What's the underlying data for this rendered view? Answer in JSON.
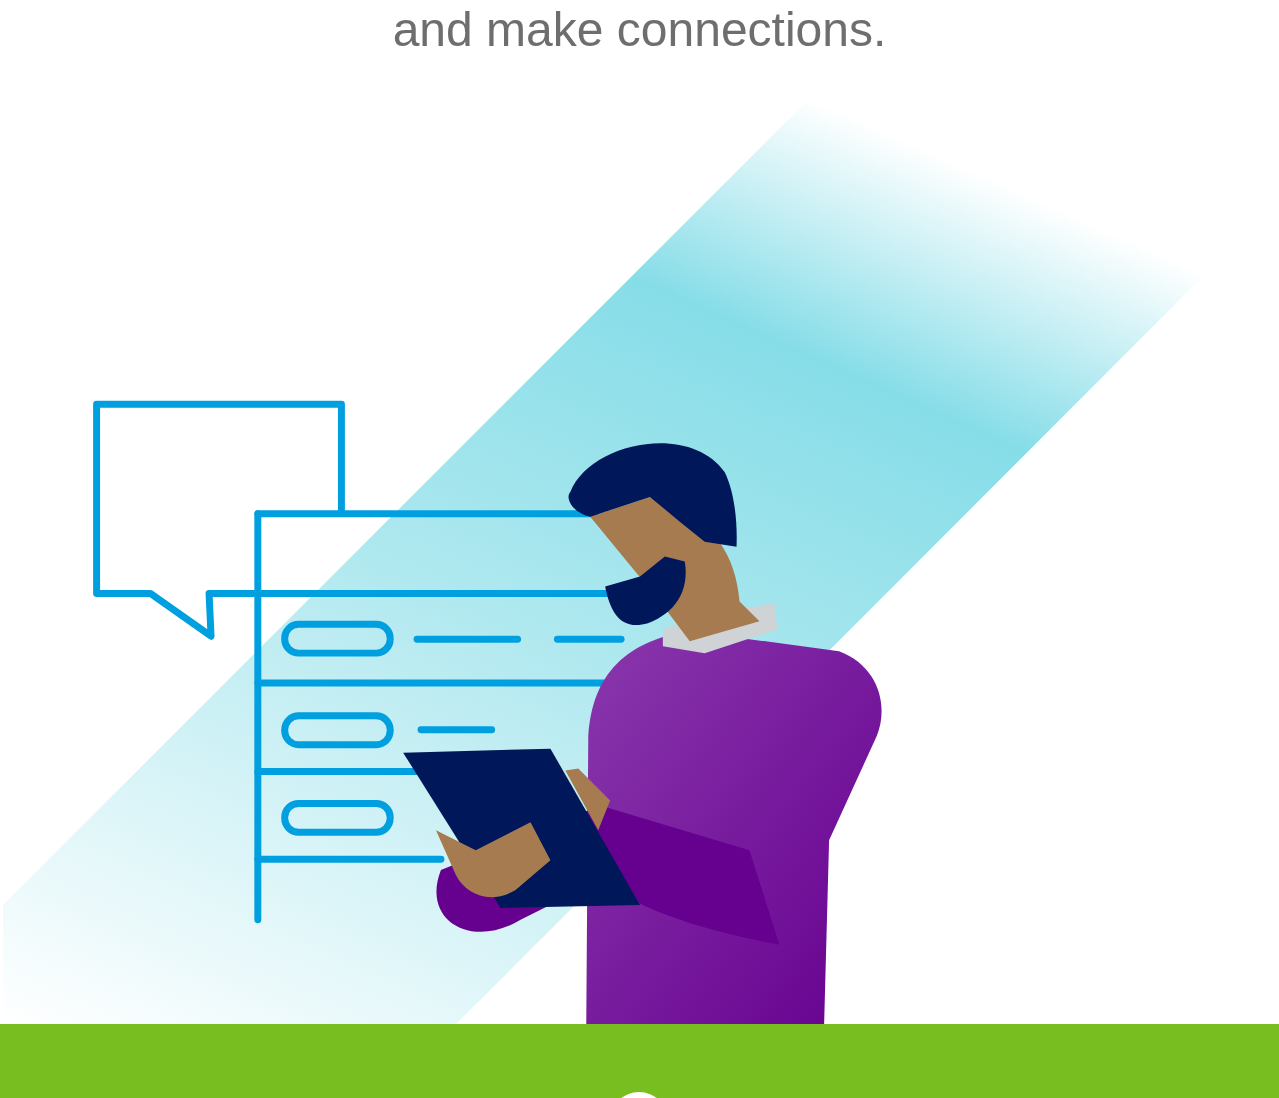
{
  "heading": {
    "text": "and make connections."
  }
}
